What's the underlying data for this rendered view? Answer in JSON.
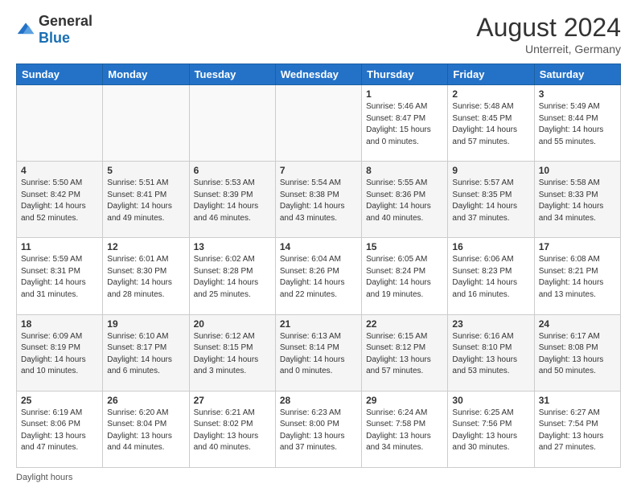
{
  "logo": {
    "general": "General",
    "blue": "Blue"
  },
  "title": "August 2024",
  "location": "Unterreit, Germany",
  "days_of_week": [
    "Sunday",
    "Monday",
    "Tuesday",
    "Wednesday",
    "Thursday",
    "Friday",
    "Saturday"
  ],
  "footer": "Daylight hours",
  "weeks": [
    [
      {
        "day": "",
        "info": ""
      },
      {
        "day": "",
        "info": ""
      },
      {
        "day": "",
        "info": ""
      },
      {
        "day": "",
        "info": ""
      },
      {
        "day": "1",
        "info": "Sunrise: 5:46 AM\nSunset: 8:47 PM\nDaylight: 15 hours\nand 0 minutes."
      },
      {
        "day": "2",
        "info": "Sunrise: 5:48 AM\nSunset: 8:45 PM\nDaylight: 14 hours\nand 57 minutes."
      },
      {
        "day": "3",
        "info": "Sunrise: 5:49 AM\nSunset: 8:44 PM\nDaylight: 14 hours\nand 55 minutes."
      }
    ],
    [
      {
        "day": "4",
        "info": "Sunrise: 5:50 AM\nSunset: 8:42 PM\nDaylight: 14 hours\nand 52 minutes."
      },
      {
        "day": "5",
        "info": "Sunrise: 5:51 AM\nSunset: 8:41 PM\nDaylight: 14 hours\nand 49 minutes."
      },
      {
        "day": "6",
        "info": "Sunrise: 5:53 AM\nSunset: 8:39 PM\nDaylight: 14 hours\nand 46 minutes."
      },
      {
        "day": "7",
        "info": "Sunrise: 5:54 AM\nSunset: 8:38 PM\nDaylight: 14 hours\nand 43 minutes."
      },
      {
        "day": "8",
        "info": "Sunrise: 5:55 AM\nSunset: 8:36 PM\nDaylight: 14 hours\nand 40 minutes."
      },
      {
        "day": "9",
        "info": "Sunrise: 5:57 AM\nSunset: 8:35 PM\nDaylight: 14 hours\nand 37 minutes."
      },
      {
        "day": "10",
        "info": "Sunrise: 5:58 AM\nSunset: 8:33 PM\nDaylight: 14 hours\nand 34 minutes."
      }
    ],
    [
      {
        "day": "11",
        "info": "Sunrise: 5:59 AM\nSunset: 8:31 PM\nDaylight: 14 hours\nand 31 minutes."
      },
      {
        "day": "12",
        "info": "Sunrise: 6:01 AM\nSunset: 8:30 PM\nDaylight: 14 hours\nand 28 minutes."
      },
      {
        "day": "13",
        "info": "Sunrise: 6:02 AM\nSunset: 8:28 PM\nDaylight: 14 hours\nand 25 minutes."
      },
      {
        "day": "14",
        "info": "Sunrise: 6:04 AM\nSunset: 8:26 PM\nDaylight: 14 hours\nand 22 minutes."
      },
      {
        "day": "15",
        "info": "Sunrise: 6:05 AM\nSunset: 8:24 PM\nDaylight: 14 hours\nand 19 minutes."
      },
      {
        "day": "16",
        "info": "Sunrise: 6:06 AM\nSunset: 8:23 PM\nDaylight: 14 hours\nand 16 minutes."
      },
      {
        "day": "17",
        "info": "Sunrise: 6:08 AM\nSunset: 8:21 PM\nDaylight: 14 hours\nand 13 minutes."
      }
    ],
    [
      {
        "day": "18",
        "info": "Sunrise: 6:09 AM\nSunset: 8:19 PM\nDaylight: 14 hours\nand 10 minutes."
      },
      {
        "day": "19",
        "info": "Sunrise: 6:10 AM\nSunset: 8:17 PM\nDaylight: 14 hours\nand 6 minutes."
      },
      {
        "day": "20",
        "info": "Sunrise: 6:12 AM\nSunset: 8:15 PM\nDaylight: 14 hours\nand 3 minutes."
      },
      {
        "day": "21",
        "info": "Sunrise: 6:13 AM\nSunset: 8:14 PM\nDaylight: 14 hours\nand 0 minutes."
      },
      {
        "day": "22",
        "info": "Sunrise: 6:15 AM\nSunset: 8:12 PM\nDaylight: 13 hours\nand 57 minutes."
      },
      {
        "day": "23",
        "info": "Sunrise: 6:16 AM\nSunset: 8:10 PM\nDaylight: 13 hours\nand 53 minutes."
      },
      {
        "day": "24",
        "info": "Sunrise: 6:17 AM\nSunset: 8:08 PM\nDaylight: 13 hours\nand 50 minutes."
      }
    ],
    [
      {
        "day": "25",
        "info": "Sunrise: 6:19 AM\nSunset: 8:06 PM\nDaylight: 13 hours\nand 47 minutes."
      },
      {
        "day": "26",
        "info": "Sunrise: 6:20 AM\nSunset: 8:04 PM\nDaylight: 13 hours\nand 44 minutes."
      },
      {
        "day": "27",
        "info": "Sunrise: 6:21 AM\nSunset: 8:02 PM\nDaylight: 13 hours\nand 40 minutes."
      },
      {
        "day": "28",
        "info": "Sunrise: 6:23 AM\nSunset: 8:00 PM\nDaylight: 13 hours\nand 37 minutes."
      },
      {
        "day": "29",
        "info": "Sunrise: 6:24 AM\nSunset: 7:58 PM\nDaylight: 13 hours\nand 34 minutes."
      },
      {
        "day": "30",
        "info": "Sunrise: 6:25 AM\nSunset: 7:56 PM\nDaylight: 13 hours\nand 30 minutes."
      },
      {
        "day": "31",
        "info": "Sunrise: 6:27 AM\nSunset: 7:54 PM\nDaylight: 13 hours\nand 27 minutes."
      }
    ]
  ]
}
